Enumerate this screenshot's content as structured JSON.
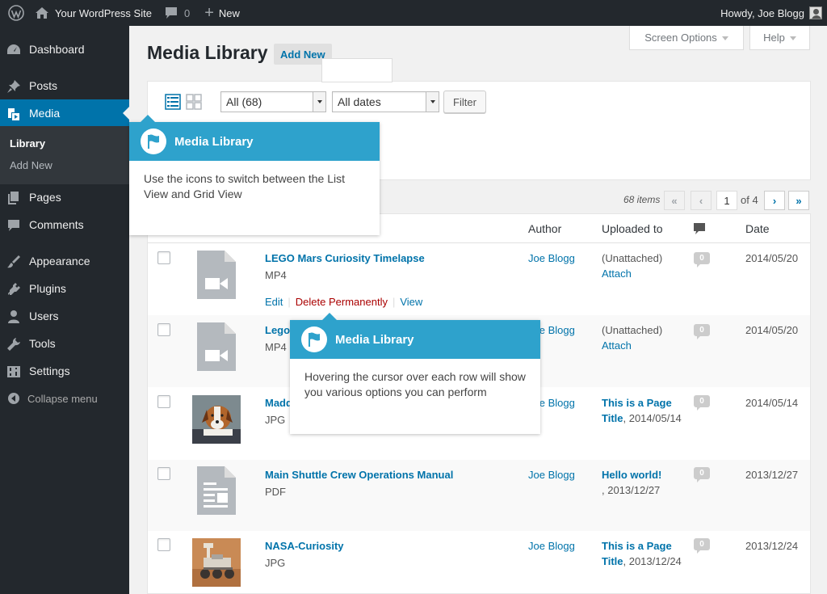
{
  "adminbar": {
    "site_name": "Your WordPress Site",
    "comments_count": "0",
    "new_label": "New",
    "greeting": "Howdy, Joe Blogg"
  },
  "sidebar": {
    "items": [
      {
        "label": "Dashboard",
        "icon": "dashboard-icon"
      },
      {
        "label": "Posts",
        "icon": "pin-icon"
      },
      {
        "label": "Media",
        "icon": "media-icon"
      },
      {
        "label": "Pages",
        "icon": "pages-icon"
      },
      {
        "label": "Comments",
        "icon": "comments-icon"
      },
      {
        "label": "Appearance",
        "icon": "brush-icon"
      },
      {
        "label": "Plugins",
        "icon": "plugin-icon"
      },
      {
        "label": "Users",
        "icon": "users-icon"
      },
      {
        "label": "Tools",
        "icon": "wrench-icon"
      },
      {
        "label": "Settings",
        "icon": "settings-icon"
      }
    ],
    "submenu": {
      "library": "Library",
      "add_new": "Add New"
    },
    "collapse": "Collapse menu"
  },
  "screen_options": "Screen Options",
  "help": "Help",
  "page": {
    "title": "Media Library",
    "add_new": "Add New"
  },
  "filters": {
    "type_select": "All (68)",
    "date_select": "All dates",
    "filter_button": "Filter"
  },
  "pagination": {
    "count": "68 items",
    "first": "«",
    "prev": "‹",
    "current": "1",
    "of": "of 4",
    "next": "›",
    "last": "»"
  },
  "table": {
    "headers": {
      "author": "Author",
      "uploaded": "Uploaded to",
      "date": "Date"
    },
    "rows": [
      {
        "title": "LEGO Mars Curiosity Timelapse",
        "type": "MP4",
        "author": "Joe Blogg",
        "uploaded": "(Unattached)",
        "uploaded_link": "Attach",
        "comments": "0",
        "date": "2014/05/20"
      },
      {
        "title": "Lego",
        "type": "MP4",
        "author": "Joe Blogg",
        "uploaded": "(Unattached)",
        "uploaded_link": "Attach",
        "comments": "0",
        "date": "2014/05/20"
      },
      {
        "title": "Madd",
        "type": "JPG",
        "author": "Joe Blogg",
        "uploaded_title": "This is a Page Title",
        "uploaded_date": ", 2014/05/14",
        "comments": "0",
        "date": "2014/05/14"
      },
      {
        "title": "Main Shuttle Crew Operations Manual",
        "type": "PDF",
        "author": "Joe Blogg",
        "uploaded_title": "Hello world!",
        "uploaded_date": ", 2013/12/27",
        "comments": "0",
        "date": "2013/12/27"
      },
      {
        "title": "NASA-Curiosity",
        "type": "JPG",
        "author": "Joe Blogg",
        "uploaded_title": "This is a Page Title",
        "uploaded_date": ", 2013/12/24",
        "comments": "0",
        "date": "2013/12/24"
      }
    ],
    "row_actions": {
      "edit": "Edit",
      "delete": "Delete Permanently",
      "view": "View",
      "separator": "|"
    }
  },
  "tooltips": [
    {
      "title": "Media Library",
      "body": "Use the icons to switch between the List View and Grid View"
    },
    {
      "title": "Media Library",
      "body": "Hovering the cursor over each row will show you various options you can perform"
    }
  ],
  "colors": {
    "adminbar_bg": "#23282d",
    "menu_active": "#0073aa",
    "link": "#0073aa",
    "delete": "#aa0000",
    "tooltip_header": "#2ea2cc"
  }
}
